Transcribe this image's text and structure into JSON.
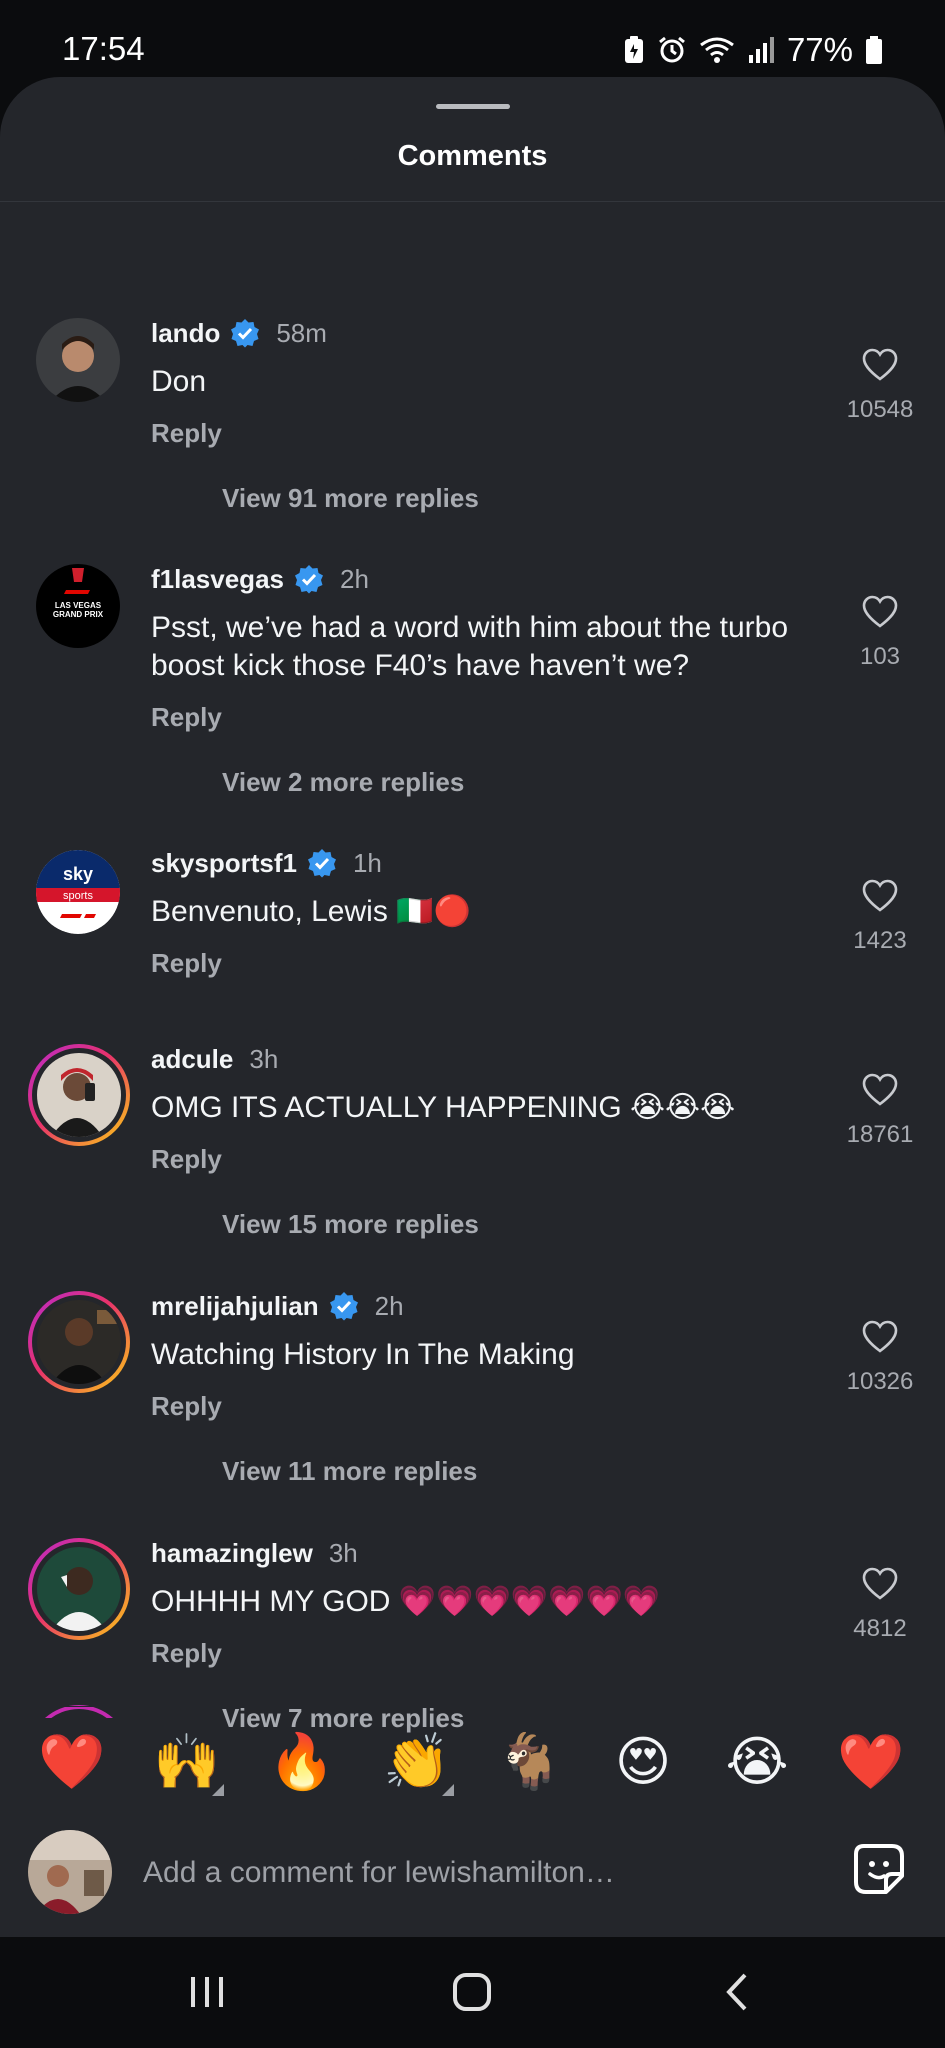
{
  "status": {
    "time": "17:54",
    "battery": "77%",
    "icons": [
      "battery-saver-icon",
      "alarm-icon",
      "wifi-icon",
      "signal-icon",
      "battery-icon"
    ]
  },
  "sheet": {
    "title": "Comments"
  },
  "comments": [
    {
      "user": "lando",
      "verified": true,
      "time": "58m",
      "text": "Don",
      "reply": "Reply",
      "likes": "10548",
      "more": "View 91 more replies"
    },
    {
      "user": "f1lasvegas",
      "verified": true,
      "time": "2h",
      "text": "Psst, we’ve had a word with him about the turbo boost kick those F40’s have haven’t we?",
      "reply": "Reply",
      "likes": "103",
      "more": "View 2 more replies"
    },
    {
      "user": "skysportsf1",
      "verified": true,
      "time": "1h",
      "text": "Benvenuto, Lewis 🇮🇹🔴",
      "reply": "Reply",
      "likes": "1423",
      "more": ""
    },
    {
      "user": "adcule",
      "verified": false,
      "time": "3h",
      "text": "OMG ITS ACTUALLY HAPPENING 😭😭😭",
      "reply": "Reply",
      "likes": "18761",
      "more": "View 15 more replies"
    },
    {
      "user": "mrelijahjulian",
      "verified": true,
      "time": "2h",
      "text": "Watching History In The Making",
      "reply": "Reply",
      "likes": "10326",
      "more": "View 11 more replies"
    },
    {
      "user": "hamazinglew",
      "verified": false,
      "time": "3h",
      "text": "OHHHH MY GOD 💗💗💗💗💗💗💗",
      "reply": "Reply",
      "likes": "4812",
      "more": "View 7 more replies"
    }
  ],
  "avatars": {
    "f1lasvegas": [
      "LAS VEGAS",
      "GRAND PRIX"
    ],
    "skysportsf1": [
      "sky",
      "sports"
    ]
  },
  "reactions": [
    "❤️",
    "🙌",
    "🔥",
    "👏",
    "🐐",
    "😍",
    "😭",
    "❤️"
  ],
  "composer": {
    "placeholder": "Add a comment for lewishamilton…"
  },
  "colors": {
    "sheet_bg": "#24262b",
    "verified": "#3897f0",
    "muted_text": "#a8abb1"
  }
}
